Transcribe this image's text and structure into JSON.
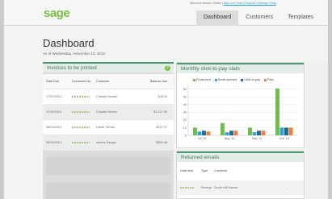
{
  "header": {
    "logo": "sage",
    "welcome_text": "Welcome Mariano Dellas |",
    "welcome_links": "Sign out | Help & Support | Settings | Help",
    "nav": [
      "Dashboard",
      "Customers",
      "Templates"
    ],
    "active_nav": 0
  },
  "page": {
    "title": "Dashboard",
    "date": "As of Wednesday, November 13, 2013"
  },
  "invoices": {
    "title": "Invoices to be printed",
    "help": "?",
    "columns": [
      "Date Due",
      "Document No.",
      "Customer",
      "Balance due"
    ],
    "rows": [
      {
        "date": "17/07/2013",
        "customer": "Coastal Homes",
        "balance": "$28.00"
      },
      {
        "date": "17/10/2013",
        "customer": "Coastal Homes",
        "balance": "$1,217.00"
      },
      {
        "date": "08/01/2013",
        "customer": "Home Trends",
        "balance": "$137.07"
      },
      {
        "date": "08/10/2013",
        "customer": "Interior Design",
        "balance": "$655.06"
      }
    ]
  },
  "chart_panel": {
    "title": "Monthly click-to-pay stats"
  },
  "chart_data": {
    "type": "bar",
    "categories": [
      "Jul '13",
      "Aug '13",
      "Sep '13",
      "Oct '13"
    ],
    "series": [
      {
        "name": "Email sent",
        "color": "#6cc04a",
        "values": [
          10,
          16,
          10,
          61
        ]
      },
      {
        "name": "Email opened",
        "color": "#3aa1d8",
        "values": [
          5,
          4,
          4,
          10
        ]
      },
      {
        "name": "Click-to-pay",
        "color": "#1f6a96",
        "values": [
          6,
          6,
          6,
          10
        ]
      },
      {
        "name": "Paid",
        "color": "#f07f3c",
        "values": [
          5,
          6,
          6,
          10
        ]
      }
    ],
    "x_ticks": [
      0,
      2,
      4,
      6
    ],
    "x_tick_labels": [
      "Jul '13",
      "Aug '13",
      "Sep '13",
      "Oct '13"
    ],
    "y_ticks": [
      0,
      10,
      20,
      30,
      40,
      50,
      60
    ],
    "ylim": [
      0,
      65
    ]
  },
  "returned": {
    "title": "Returned emails",
    "columns": [
      "Date sent",
      "Type",
      "Customer"
    ],
    "rows": [
      {
        "type": "Receipt",
        "customer": "South Hill Homes"
      }
    ]
  }
}
